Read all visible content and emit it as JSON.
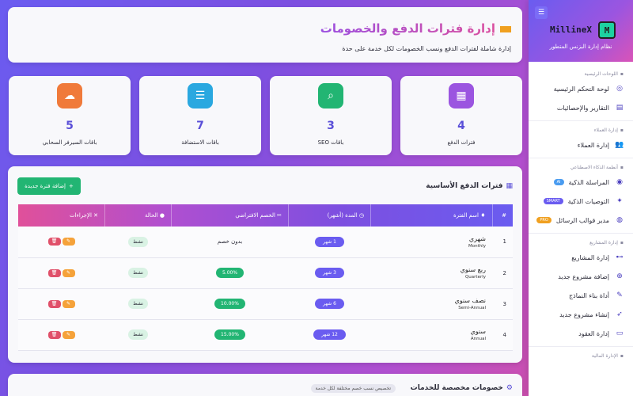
{
  "sidebar": {
    "brand_name": "MillineX",
    "brand_logo_letter": "M",
    "tagline": "نظام إدارة البزنس المتطور",
    "sections": [
      {
        "title": "اللوحات الرئيسية",
        "items": [
          {
            "label": "لوحة التحكم الرئيسية",
            "icon": "dashboard-icon"
          },
          {
            "label": "التقارير والإحصائيات",
            "icon": "chart-icon"
          }
        ]
      },
      {
        "title": "إدارة العملاء",
        "items": [
          {
            "label": "إدارة العملاء",
            "icon": "users-icon"
          }
        ]
      },
      {
        "title": "أنظمة الذكاء الاصطناعي",
        "items": [
          {
            "label": "المراسلة الذكية",
            "icon": "robot-icon",
            "badge": "AI"
          },
          {
            "label": "التوصيات الذكية",
            "icon": "bulb-icon",
            "badge": "SMART"
          },
          {
            "label": "مدير قوالب الرسائل",
            "icon": "template-icon",
            "badge": "PRO"
          }
        ]
      },
      {
        "title": "إدارة المشاريع",
        "items": [
          {
            "label": "إدارة المشاريع",
            "icon": "project-icon"
          },
          {
            "label": "إضافة مشروع جديد",
            "icon": "plus-circle-icon"
          },
          {
            "label": "أداة بناء النماذج",
            "icon": "pen-icon"
          },
          {
            "label": "إنشاء مشروع جديد",
            "icon": "rocket-icon"
          },
          {
            "label": "إدارة العقود",
            "icon": "contract-icon"
          }
        ]
      },
      {
        "title": "الإدارة المالية",
        "items": []
      }
    ],
    "colors": {
      "accent": "#6a5cf0",
      "ai_badge": "#4a9cf0",
      "smart_badge": "#6a5cf0",
      "pro_badge": "#f0a020"
    }
  },
  "header": {
    "title": "إدارة فترات الدفع والخصومات",
    "subtitle": "إدارة شاملة لفترات الدفع ونسب الخصومات لكل خدمة على حدة"
  },
  "stats": [
    {
      "value": "4",
      "label": "فترات الدفع",
      "icon": "calendar-icon",
      "color": "#9b55e0"
    },
    {
      "value": "3",
      "label": "باقات SEO",
      "icon": "search-icon",
      "color": "#22b573"
    },
    {
      "value": "7",
      "label": "باقات الاستضافة",
      "icon": "server-icon",
      "color": "#2aa8e0"
    },
    {
      "value": "5",
      "label": "باقات السيرفر السحابي",
      "icon": "cloud-icon",
      "color": "#f07a3a"
    }
  ],
  "periods_table": {
    "title": "فترات الدفع الأساسية",
    "add_button": "إضافة فترة جديدة",
    "columns": [
      "#",
      "اسم الفترة",
      "المدة (أشهر)",
      "الخصم الافتراضي",
      "الحالة",
      "الإجراءات"
    ],
    "rows": [
      {
        "index": "1",
        "name_ar": "شهري",
        "name_en": "Monthly",
        "duration": "1 شهر",
        "discount": "بدون خصم",
        "has_discount": false,
        "status": "نشط"
      },
      {
        "index": "2",
        "name_ar": "ربع سنوي",
        "name_en": "Quarterly",
        "duration": "3 شهر",
        "discount": "5.00%",
        "has_discount": true,
        "status": "نشط"
      },
      {
        "index": "3",
        "name_ar": "نصف سنوي",
        "name_en": "Semi-Annual",
        "duration": "6 شهر",
        "discount": "10.00%",
        "has_discount": true,
        "status": "نشط"
      },
      {
        "index": "4",
        "name_ar": "سنوي",
        "name_en": "Annual",
        "duration": "12 شهر",
        "discount": "15.00%",
        "has_discount": true,
        "status": "نشط"
      }
    ]
  },
  "service_discounts": {
    "title": "خصومات مخصصة للخدمات",
    "badge": "تخصيص نسب خصم مختلفة لكل خدمة"
  }
}
